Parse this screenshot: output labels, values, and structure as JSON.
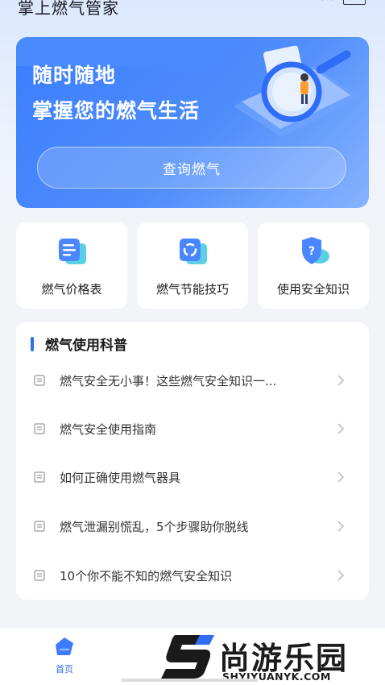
{
  "app": {
    "title": "掌上燃气管家"
  },
  "hero": {
    "line1": "随时随地",
    "line2": "掌握您的燃气生活",
    "button_label": "查询燃气"
  },
  "quick_cards": [
    {
      "label": "燃气价格表",
      "icon": "price-list-icon"
    },
    {
      "label": "燃气节能技巧",
      "icon": "recycle-icon"
    },
    {
      "label": "使用安全知识",
      "icon": "shield-question-icon"
    }
  ],
  "articles": {
    "title": "燃气使用科普",
    "items": [
      {
        "text": "燃气安全无小事！这些燃气安全知识一..."
      },
      {
        "text": "燃气安全使用指南"
      },
      {
        "text": "如何正确使用燃气器具"
      },
      {
        "text": "燃气泄漏别慌乱，5个步骤助你脱线"
      },
      {
        "text": "10个你不能不知的燃气安全知识"
      }
    ]
  },
  "bottom_nav": {
    "home_label": "首页"
  },
  "watermark": {
    "cn": "尚游乐园",
    "en": "SHYIYUANYK.COM"
  },
  "colors": {
    "accent": "#2f6df6",
    "hero_start": "#3b7dff",
    "hero_end": "#86b3ff"
  }
}
